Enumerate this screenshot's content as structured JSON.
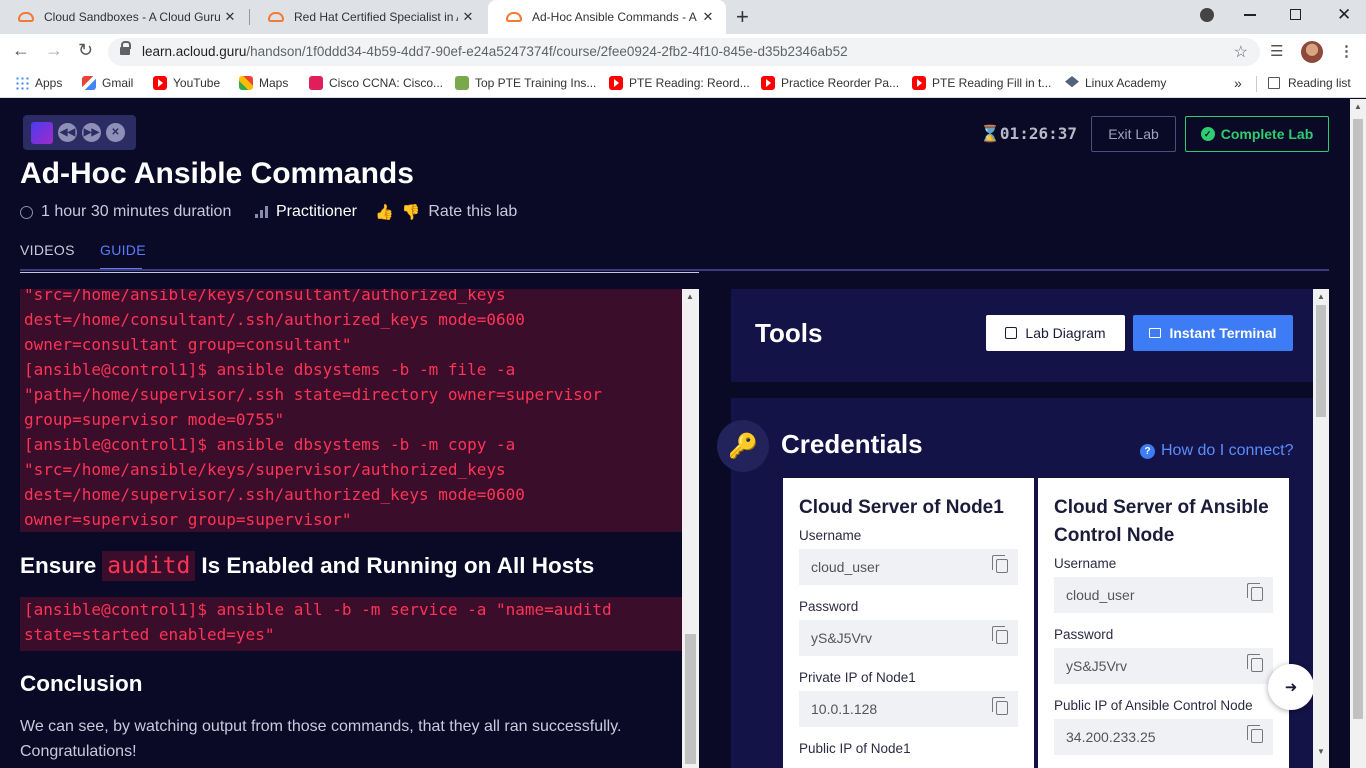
{
  "browser": {
    "tabs": [
      {
        "title": "Cloud Sandboxes - A Cloud Guru"
      },
      {
        "title": "Red Hat Certified Specialist in An"
      },
      {
        "title": "Ad-Hoc Ansible Commands - A C"
      }
    ],
    "close_glyph": "✕",
    "new_tab_glyph": "+",
    "url_host": "learn.acloud.guru",
    "url_path": "/handson/1f0ddd34-4b59-4dd7-90ef-e24a5247374f/course/2fee0924-2fb2-4f10-845e-d35b2346ab52",
    "bookmarks": [
      {
        "label": "Apps",
        "icon": "apps-icon"
      },
      {
        "label": "Gmail",
        "icon": "gmail-icon"
      },
      {
        "label": "YouTube",
        "icon": "youtube-icon"
      },
      {
        "label": "Maps",
        "icon": "maps-icon"
      },
      {
        "label": "Cisco CCNA: Cisco...",
        "icon": "cisco-icon"
      },
      {
        "label": "Top PTE Training Ins...",
        "icon": "pte-icon"
      },
      {
        "label": "PTE Reading: Reord...",
        "icon": "youtube-icon"
      },
      {
        "label": "Practice Reorder Pa...",
        "icon": "youtube-icon"
      },
      {
        "label": "PTE Reading Fill in t...",
        "icon": "youtube-icon"
      },
      {
        "label": "Linux Academy",
        "icon": "linux-academy-icon"
      }
    ],
    "reading_list": "Reading list",
    "more_glyph": "»"
  },
  "lab": {
    "timer": "01:26:37",
    "exit_label": "Exit Lab",
    "complete_label": "Complete Lab",
    "title": "Ad-Hoc Ansible Commands",
    "duration": "1 hour 30 minutes duration",
    "level": "Practitioner",
    "rate": "Rate this lab",
    "tabs": [
      "VIDEOS",
      "GUIDE"
    ]
  },
  "guide": {
    "code_block_1": "\"src=/home/ansible/keys/consultant/authorized_keys\ndest=/home/consultant/.ssh/authorized_keys mode=0600\nowner=consultant group=consultant\"\n[ansible@control1]$ ansible dbsystems -b -m file -a\n\"path=/home/supervisor/.ssh state=directory owner=supervisor\ngroup=supervisor mode=0755\"\n[ansible@control1]$ ansible dbsystems -b -m copy -a\n\"src=/home/ansible/keys/supervisor/authorized_keys\ndest=/home/supervisor/.ssh/authorized_keys mode=0600\nowner=supervisor group=supervisor\"",
    "heading_ensure_pre": "Ensure",
    "heading_ensure_kw": "auditd",
    "heading_ensure_post": "Is Enabled and Running on All Hosts",
    "code_block_2": "[ansible@control1]$ ansible all -b -m service -a \"name=auditd\nstate=started enabled=yes\"",
    "heading_conclusion": "Conclusion",
    "conclusion_text": "We can see, by watching output from those commands, that they all ran successfully. Congratulations!"
  },
  "tools": {
    "title": "Tools",
    "diagram_label": "Lab Diagram",
    "terminal_label": "Instant Terminal"
  },
  "credentials": {
    "title": "Credentials",
    "help_link": "How do I connect?",
    "cards": [
      {
        "title": "Cloud Server of Node1",
        "fields": [
          {
            "label": "Username",
            "value": "cloud_user"
          },
          {
            "label": "Password",
            "value": "yS&J5Vrv"
          },
          {
            "label": "Private IP of Node1",
            "value": "10.0.1.128"
          },
          {
            "label": "Public IP of Node1",
            "value": ""
          }
        ]
      },
      {
        "title": "Cloud Server of Ansible Control Node",
        "fields": [
          {
            "label": "Username",
            "value": "cloud_user"
          },
          {
            "label": "Password",
            "value": "yS&J5Vrv"
          },
          {
            "label": "Public IP of Ansible Control Node",
            "value": "34.200.233.25"
          }
        ]
      }
    ]
  },
  "colors": {
    "page_bg": "#0a0a26",
    "accent_blue": "#5b7cfa",
    "complete_green": "#2ecc71",
    "code_text": "#ff3355",
    "code_bg": "#3a0d2b"
  }
}
